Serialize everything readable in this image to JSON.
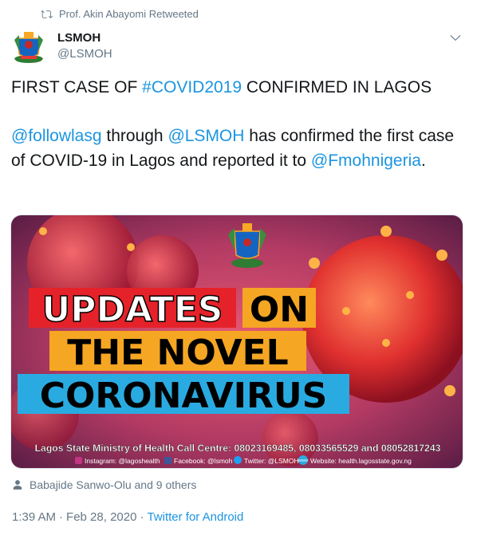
{
  "retweet": {
    "text": "Prof. Akin Abayomi Retweeted"
  },
  "author": {
    "display_name": "LSMOH",
    "handle": "@LSMOH"
  },
  "tweet": {
    "line1_prefix": "FIRST CASE OF ",
    "line1_hashtag": "#COVID2019",
    "line1_suffix": " CONFIRMED IN LAGOS",
    "mention1": "@followlasg",
    "text_a": " through ",
    "mention2": "@LSMOH",
    "text_b": " has confirmed the first case of COVID-19 in Lagos and reported it to ",
    "mention3": "@Fmohnigeria",
    "text_c": "."
  },
  "media": {
    "headline_1a": "UPDATES",
    "headline_1b": "ON",
    "headline_2": "THE NOVEL",
    "headline_3": "CORONAVIRUS",
    "call_centre": "Lagos State Ministry of Health Call Centre: 08023169485, 08033565529 and 08052817243",
    "instagram": "Instagram: @lagoshealth",
    "facebook": "Facebook: @lsmoh",
    "twitter": "Twitter: @LSMOH",
    "website": "Website: health.lagosstate.gov.ng",
    "www_badge": "WWW"
  },
  "tagged": {
    "text": "Babajide Sanwo-Olu and 9 others"
  },
  "meta": {
    "time": "1:39 AM",
    "separator": "·",
    "date": "Feb 28, 2020",
    "source": "Twitter for Android"
  },
  "colors": {
    "link": "#1b95e0",
    "muted": "#657786",
    "virus_red": "#d8232f",
    "banner_red": "#e52229",
    "banner_orange": "#f5a623",
    "banner_blue": "#29abe2"
  },
  "icons": {
    "retweet": "retweet-icon",
    "caret": "chevron-down-icon",
    "person": "person-icon"
  }
}
